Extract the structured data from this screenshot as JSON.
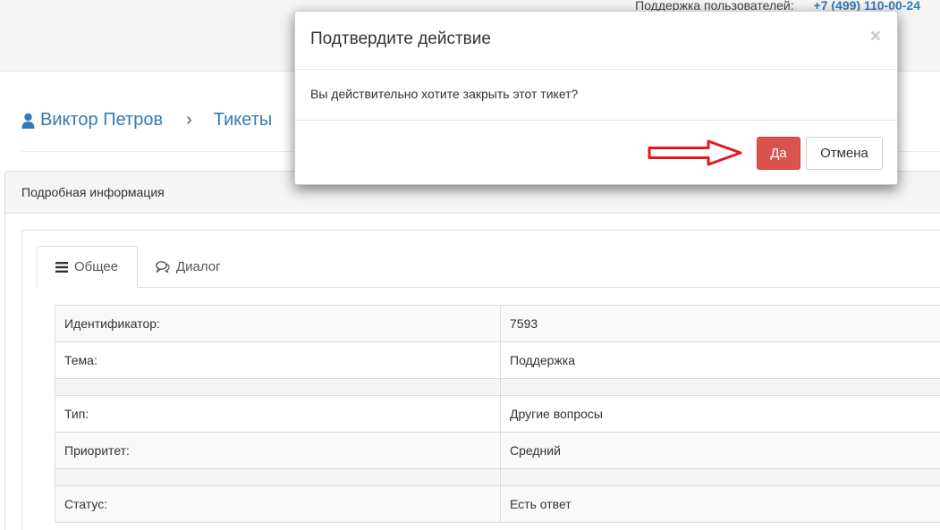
{
  "header": {
    "support_label": "Поддержка пользователей:",
    "support_phone": "+7 (499) 110-00-24"
  },
  "breadcrumb": {
    "user": "Виктор Петров",
    "separator": "›",
    "section": "Тикеты"
  },
  "panel": {
    "heading": "Подробная информация",
    "tabs": [
      {
        "label": "Общее",
        "icon": "list-icon",
        "active": true
      },
      {
        "label": "Диалог",
        "icon": "comments-icon",
        "active": false
      }
    ],
    "rows": [
      {
        "key": "Идентификатор:",
        "value": "7593"
      },
      {
        "key": "Тема:",
        "value": "Поддержка"
      },
      {
        "key": "Тип:",
        "value": "Другие вопросы"
      },
      {
        "key": "Приоритет:",
        "value": "Средний"
      },
      {
        "key": "Статус:",
        "value": "Есть ответ"
      }
    ]
  },
  "modal": {
    "title": "Подтвердите действие",
    "close": "×",
    "message": "Вы действительно хотите закрыть этот тикет?",
    "yes_label": "Да",
    "cancel_label": "Отмена"
  },
  "colors": {
    "link": "#337ab7",
    "danger": "#d9534f",
    "arrow": "#e8161b"
  }
}
